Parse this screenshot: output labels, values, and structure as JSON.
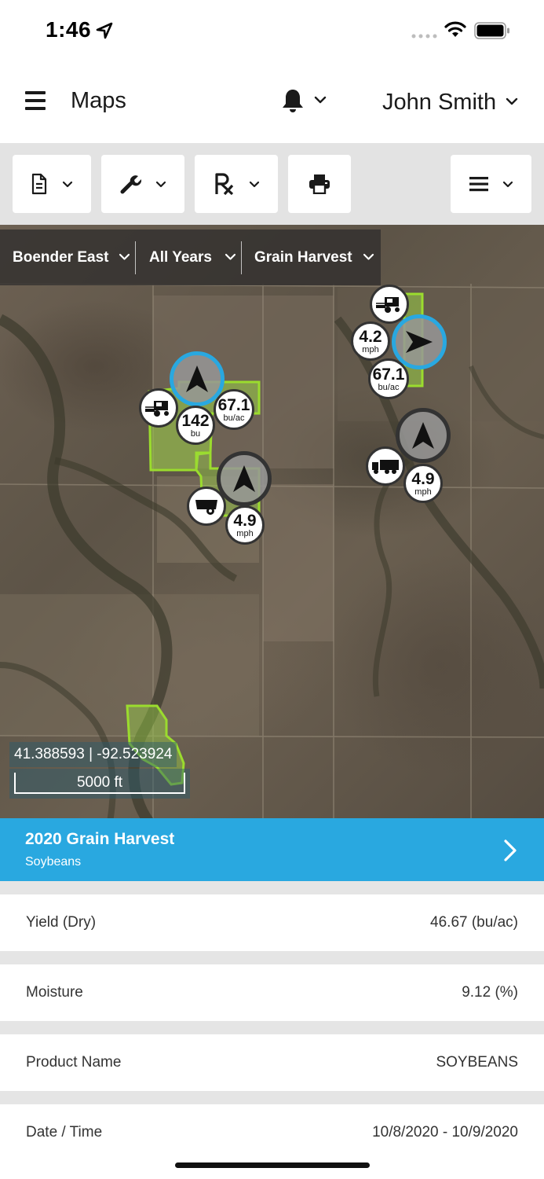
{
  "status_bar": {
    "time": "1:46"
  },
  "header": {
    "title": "Maps",
    "user": "John Smith"
  },
  "toolbar": {
    "buttons": [
      {
        "icon": "document-icon"
      },
      {
        "icon": "wrench-icon"
      },
      {
        "icon": "rx-icon"
      },
      {
        "icon": "printer-icon"
      },
      {
        "icon": "list-menu-icon"
      }
    ]
  },
  "filters": {
    "field": "Boender East",
    "years": "All Years",
    "operation": "Grain Harvest"
  },
  "map": {
    "coordinates": "41.388593 | -92.523924",
    "scale": "5000 ft",
    "markers": {
      "m1_yield": "67.1",
      "m1_yield_unit": "bu/ac",
      "m1_total": "142",
      "m1_total_unit": "bu",
      "m2_speed": "4.9",
      "m2_speed_unit": "mph",
      "m3_speed": "4.2",
      "m3_speed_unit": "mph",
      "m3_yield": "67.1",
      "m3_yield_unit": "bu/ac",
      "m4_speed": "4.9",
      "m4_speed_unit": "mph"
    }
  },
  "banner": {
    "title": "2020 Grain Harvest",
    "subtitle": "Soybeans"
  },
  "details": [
    {
      "label": "Yield (Dry)",
      "value": "46.67 (bu/ac)"
    },
    {
      "label": "Moisture",
      "value": "9.12 (%)"
    },
    {
      "label": "Product Name",
      "value": "SOYBEANS"
    },
    {
      "label": "Date / Time",
      "value": "10/8/2020 - 10/9/2020"
    }
  ],
  "colors": {
    "accent": "#29a8e0",
    "field_green": "#8fd43a",
    "selected_ring": "#29a8e0"
  }
}
